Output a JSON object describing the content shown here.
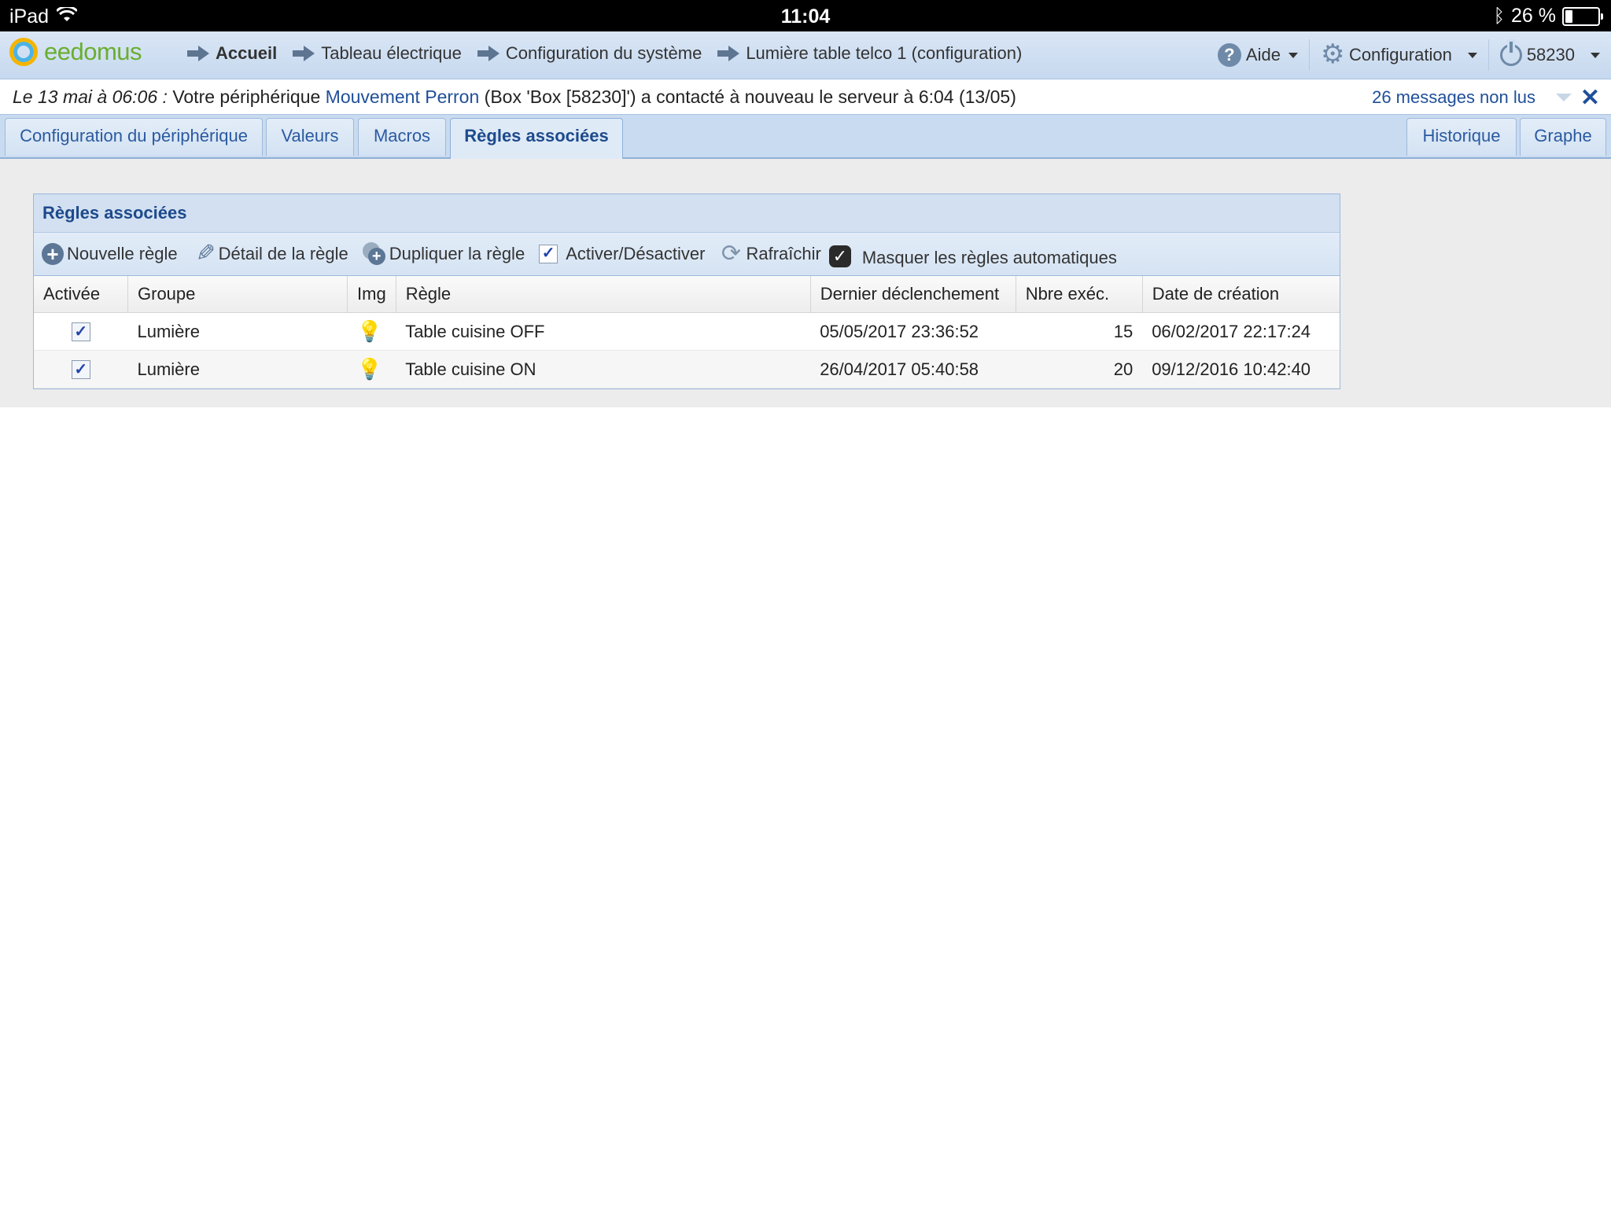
{
  "status_bar": {
    "device": "iPad",
    "time": "11:04",
    "battery": "26 %",
    "battery_level_percent": 26
  },
  "header": {
    "logo": "eedomus",
    "breadcrumbs": [
      "Accueil",
      "Tableau électrique",
      "Configuration du système",
      "Lumière table telco 1 (configuration)"
    ],
    "help_label": "Aide",
    "config_label": "Configuration",
    "account_label": "58230"
  },
  "message": {
    "date": "Le 13 mai à 06:06 :",
    "prefix": "Votre périphérique",
    "device_link": "Mouvement Perron",
    "suffix": "(Box 'Box [58230]') a contacté à nouveau le serveur à 6:04 (13/05)",
    "unread": "26 messages non lus"
  },
  "tabs": {
    "left": [
      "Configuration du périphérique",
      "Valeurs",
      "Macros",
      "Règles associées"
    ],
    "active": "Règles associées",
    "right": [
      "Historique",
      "Graphe"
    ]
  },
  "panel": {
    "title": "Règles associées",
    "toolbar": {
      "new_rule": "Nouvelle règle",
      "rule_detail": "Détail de la règle",
      "duplicate": "Dupliquer la règle",
      "toggle": "Activer/Désactiver",
      "refresh": "Rafraîchir",
      "hide_auto": "Masquer les règles automatiques"
    },
    "columns": [
      "Activée",
      "Groupe",
      "Img",
      "Règle",
      "Dernier déclenchement",
      "Nbre exéc.",
      "Date de création"
    ],
    "rows": [
      {
        "enabled": true,
        "group": "Lumière",
        "rule": "Table cuisine OFF",
        "last_trigger": "05/05/2017 23:36:52",
        "exec_count": "15",
        "created": "06/02/2017 22:17:24"
      },
      {
        "enabled": true,
        "group": "Lumière",
        "rule": "Table cuisine ON",
        "last_trigger": "26/04/2017 05:40:58",
        "exec_count": "20",
        "created": "09/12/2016 10:42:40"
      }
    ]
  }
}
